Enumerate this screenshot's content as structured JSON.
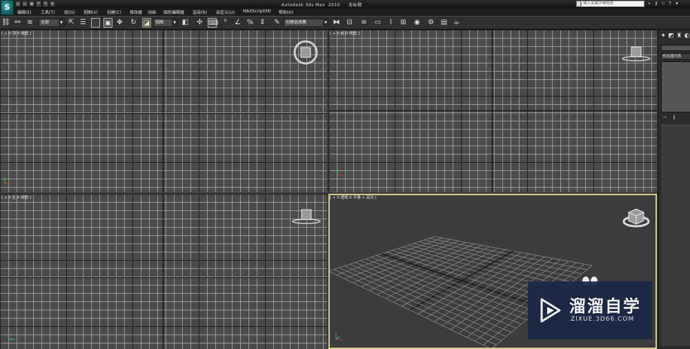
{
  "titlebar": {
    "app_logo": "S",
    "title": "Autodesk 3ds Max  2010     无标题",
    "search_placeholder": "键入关键字或短语",
    "quick_access": [
      "new-icon",
      "open-icon",
      "save-icon",
      "undo-icon",
      "redo-icon",
      "dropdown-icon"
    ]
  },
  "menu": {
    "items": [
      "编辑(E)",
      "工具(T)",
      "组(G)",
      "视图(V)",
      "创建(C)",
      "修改器",
      "动画",
      "图形编辑器",
      "渲染(R)",
      "自定义(U)",
      "MAXScript(M)",
      "帮助(H)"
    ]
  },
  "toolbar": {
    "selection_filter": "全部",
    "reference_coord": "视图",
    "named_selection": "创建选择集"
  },
  "viewports": {
    "top": {
      "label": "[ + 0 顶 0 线框 ]"
    },
    "front": {
      "label": "[ + 0 前 0 线框 ]"
    },
    "left": {
      "label": "[ + 0 左 0 线框 ]"
    },
    "perspective": {
      "label": "[ + 0 透视 0 平滑 + 高光 ]"
    }
  },
  "command_panel": {
    "modifier_list": "修改器列表"
  },
  "watermark": {
    "title": "溜溜自学",
    "url": "ZIXUE.3D66.COM"
  }
}
